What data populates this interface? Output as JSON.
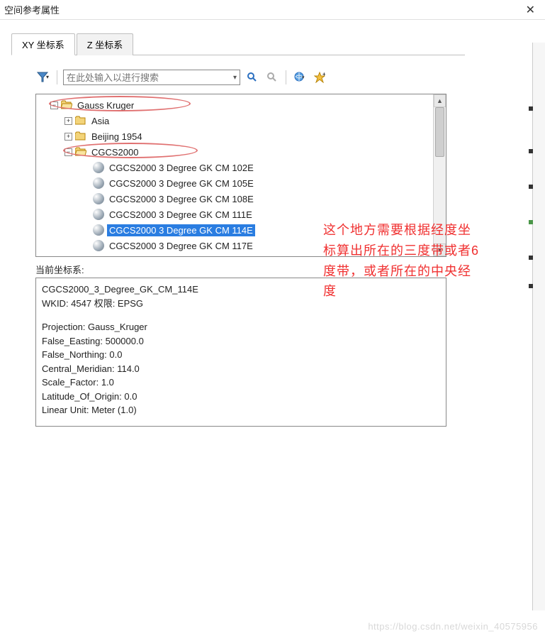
{
  "window": {
    "title": "空间参考属性"
  },
  "tabs": {
    "xy": "XY 坐标系",
    "z": "Z 坐标系"
  },
  "search": {
    "placeholder": "在此处输入以进行搜索"
  },
  "tree": {
    "root": "Gauss Kruger",
    "asia": "Asia",
    "beijing": "Beijing 1954",
    "cgcs": "CGCS2000",
    "items": [
      "CGCS2000 3 Degree GK CM 102E",
      "CGCS2000 3 Degree GK CM 105E",
      "CGCS2000 3 Degree GK CM 108E",
      "CGCS2000 3 Degree GK CM 111E",
      "CGCS2000 3 Degree GK CM 114E",
      "CGCS2000 3 Degree GK CM 117E"
    ],
    "selected_index": 4
  },
  "current": {
    "label": "当前坐标系:"
  },
  "details": {
    "name": "CGCS2000_3_Degree_GK_CM_114E",
    "wkid": "WKID: 4547 权限: EPSG",
    "projection": "Projection: Gauss_Kruger",
    "false_easting": "False_Easting: 500000.0",
    "false_northing": "False_Northing: 0.0",
    "central_meridian": "Central_Meridian: 114.0",
    "scale_factor": "Scale_Factor: 1.0",
    "latitude_origin": "Latitude_Of_Origin: 0.0",
    "linear_unit": "Linear Unit: Meter (1.0)"
  },
  "annotation": "这个地方需要根据经度坐标算出所在的三度带或者6度带，或者所在的中央经度",
  "watermark": "https://blog.csdn.net/weixin_40575956"
}
